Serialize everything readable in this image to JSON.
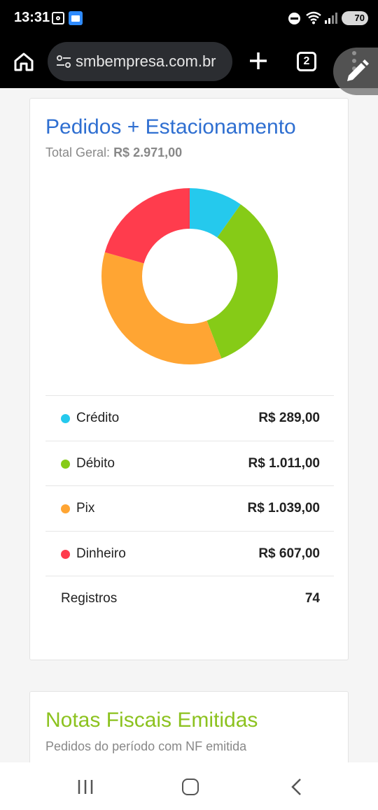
{
  "status_bar": {
    "time": "13:31",
    "battery": "70",
    "icons": [
      "screenshot-icon",
      "gallery-icon",
      "do-not-disturb-icon",
      "wifi-icon",
      "signal-icon",
      "battery-icon"
    ]
  },
  "browser": {
    "url": "smbempresa.com.br",
    "tab_count": "2",
    "icons": [
      "home-icon",
      "site-settings-icon",
      "plus-icon",
      "tabs-icon",
      "more-vert-icon",
      "edit-pencil-icon"
    ]
  },
  "card_pedidos": {
    "title": "Pedidos + Estacionamento",
    "subtitle_label": "Total Geral:",
    "subtitle_value": "R$ 2.971,00",
    "rows": [
      {
        "label": "Crédito",
        "value": "R$ 289,00",
        "color": "#25c9ed"
      },
      {
        "label": "Débito",
        "value": "R$ 1.011,00",
        "color": "#86cb17"
      },
      {
        "label": "Pix",
        "value": "R$ 1.039,00",
        "color": "#ffa533"
      },
      {
        "label": "Dinheiro",
        "value": "R$ 607,00",
        "color": "#ff3c4d"
      }
    ],
    "registros_label": "Registros",
    "registros_value": "74"
  },
  "chart_data": {
    "type": "pie",
    "categories": [
      "Crédito",
      "Débito",
      "Pix",
      "Dinheiro"
    ],
    "values": [
      289,
      1011,
      1039,
      607
    ],
    "colors": [
      "#25c9ed",
      "#86cb17",
      "#ffa533",
      "#ff3c4d"
    ],
    "donut": true
  },
  "card_notas": {
    "title": "Notas Fiscais Emitidas",
    "subtitle": "Pedidos do período com NF emitida"
  },
  "navbar": {
    "icons": [
      "recents-icon",
      "home-nav-icon",
      "back-icon"
    ]
  }
}
